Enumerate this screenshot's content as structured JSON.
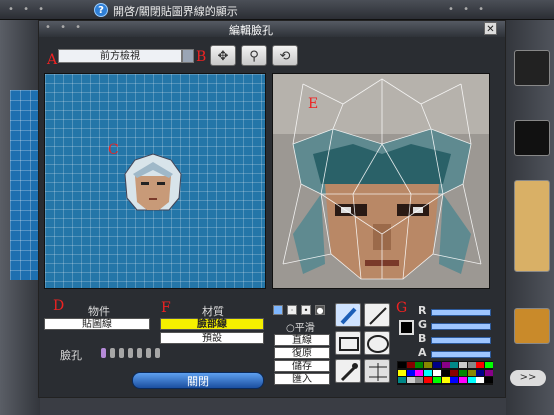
{
  "app": {
    "title": "開啓/關閉貼圖界線的顯示",
    "help_icon": "?",
    "next_button": ">>"
  },
  "dialog": {
    "title": "編輯臉孔",
    "close_icon": "✕",
    "view_select": "前方檢視",
    "tools": {
      "move": "✥",
      "zoom": "⚲",
      "rotate": "⟲"
    },
    "labels": {
      "A": "A",
      "B": "B",
      "C": "C",
      "D": "D",
      "E": "E",
      "F": "F",
      "G": "G"
    },
    "object_header": "物件",
    "object_value": "貼圖線",
    "material_header": "材質",
    "material_selected": "臉部線",
    "material_default": "預設",
    "face_label": "臉孔",
    "close_button": "關閉",
    "paint": {
      "smooth": "○平滑",
      "vertical": "直線",
      "restore": "復原",
      "save": "儲存",
      "import": "匯入",
      "channels": [
        "R",
        "G",
        "B",
        "A"
      ]
    }
  },
  "colors": {
    "grid_blue": "#2476a8",
    "close_button_blue": "#1b4fa0",
    "material_highlight": "#f5f000",
    "label_red": "#e22222"
  }
}
